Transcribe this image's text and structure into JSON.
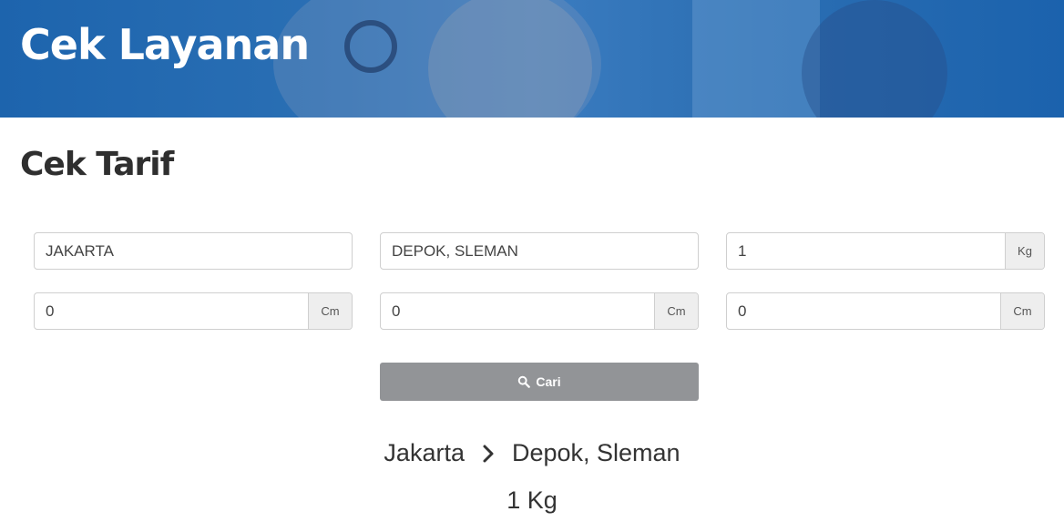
{
  "banner": {
    "title": "Cek Layanan"
  },
  "section": {
    "title": "Cek Tarif"
  },
  "form": {
    "origin": "JAKARTA",
    "destination": "DEPOK, SLEMAN",
    "weight": "1",
    "weight_unit": "Kg",
    "length": "0",
    "width": "0",
    "height": "0",
    "dimension_unit": "Cm",
    "search_label": "Cari"
  },
  "result": {
    "origin": "Jakarta",
    "destination": "Depok, Sleman",
    "weight": "1 Kg"
  },
  "colors": {
    "banner": "#2a6fb4",
    "button": "#929497",
    "unit_bg": "#eeeeee"
  }
}
